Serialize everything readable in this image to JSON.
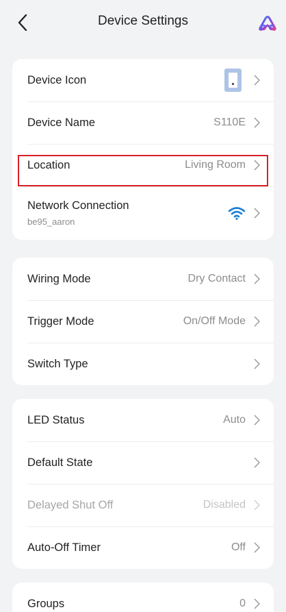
{
  "header": {
    "title": "Device Settings",
    "back_icon": "chevron-left-icon",
    "logo_icon": "brand-logo-icon"
  },
  "colors": {
    "background": "#f2f3f5",
    "card": "#ffffff",
    "wifi": "#1a7fd8",
    "highlight": "#d81f26",
    "device_thumb": "#aec4e6"
  },
  "section1": {
    "device_icon": {
      "label": "Device Icon",
      "icon": "switch-device-icon"
    },
    "device_name": {
      "label": "Device Name",
      "value": "S110E"
    },
    "location": {
      "label": "Location",
      "value": "Living Room"
    },
    "network": {
      "label": "Network Connection",
      "sub": "be95_aaron",
      "icon": "wifi-icon"
    }
  },
  "section2": {
    "wiring_mode": {
      "label": "Wiring Mode",
      "value": "Dry Contact"
    },
    "trigger_mode": {
      "label": "Trigger Mode",
      "value": "On/Off Mode"
    },
    "switch_type": {
      "label": "Switch Type",
      "value": ""
    }
  },
  "section3": {
    "led_status": {
      "label": "LED Status",
      "value": "Auto"
    },
    "default_state": {
      "label": "Default State",
      "value": ""
    },
    "delayed_shut_off": {
      "label": "Delayed Shut Off",
      "value": "Disabled"
    },
    "auto_off_timer": {
      "label": "Auto-Off Timer",
      "value": "Off"
    }
  },
  "section4": {
    "groups": {
      "label": "Groups",
      "value": "0"
    }
  }
}
